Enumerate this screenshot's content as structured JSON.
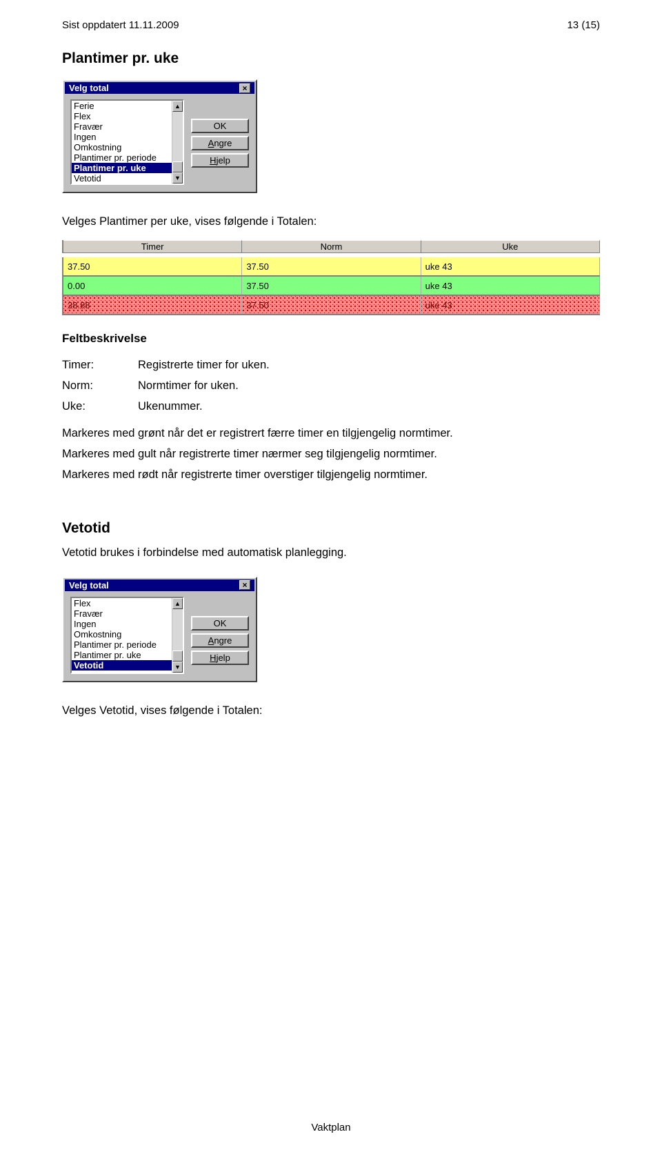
{
  "header": {
    "updated": "Sist oppdatert 11.11.2009",
    "pageno": "13 (15)"
  },
  "section1": {
    "title": "Plantimer pr. uke"
  },
  "dialog1": {
    "title": "Velg total",
    "items": [
      "Ferie",
      "Flex",
      "Fravær",
      "Ingen",
      "Omkostning",
      "Plantimer pr. periode",
      "Plantimer pr. uke",
      "Vetotid"
    ],
    "selected": "Plantimer pr. uke",
    "buttons": {
      "ok": "OK",
      "angre": "Angre",
      "hjelp": "Hjelp"
    }
  },
  "intro": "Velges Plantimer per uke, vises følgende i Totalen:",
  "table": {
    "headers": [
      "Timer",
      "Norm",
      "Uke"
    ],
    "rows": [
      {
        "timer": "37.50",
        "norm": "37.50",
        "uke": "uke 43",
        "color": "yellow"
      },
      {
        "timer": "0.00",
        "norm": "37.50",
        "uke": "uke 43",
        "color": "green"
      },
      {
        "timer": "38.88",
        "norm": "37.50",
        "uke": "uke 43",
        "color": "red"
      }
    ]
  },
  "felt": {
    "title": "Feltbeskrivelse",
    "timer": {
      "k": "Timer:",
      "v": "Registrerte timer for uken."
    },
    "norm": {
      "k": "Norm:",
      "v": "Normtimer for uken."
    },
    "uke": {
      "k": "Uke:",
      "v": "Ukenummer."
    },
    "l1": "Markeres med grønt når det er registrert færre timer en tilgjengelig normtimer.",
    "l2": "Markeres med gult når registrerte timer nærmer seg tilgjengelig normtimer.",
    "l3": "Markeres med rødt når registrerte timer overstiger tilgjengelig normtimer."
  },
  "vetotid": {
    "title": "Vetotid",
    "desc": "Vetotid brukes i forbindelse med automatisk planlegging."
  },
  "dialog2": {
    "title": "Velg total",
    "items": [
      "Flex",
      "Fravær",
      "Ingen",
      "Omkostning",
      "Plantimer pr. periode",
      "Plantimer pr. uke",
      "Vetotid"
    ],
    "selected": "Vetotid",
    "buttons": {
      "ok": "OK",
      "angre": "Angre",
      "hjelp": "Hjelp"
    }
  },
  "closing": "Velges Vetotid, vises følgende i Totalen:",
  "footer": "Vaktplan"
}
